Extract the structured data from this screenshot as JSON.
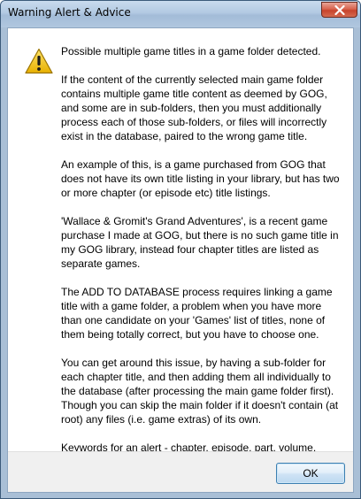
{
  "window": {
    "title": "Warning Alert & Advice"
  },
  "message": {
    "paragraphs": [
      "Possible multiple game titles in a game folder detected.",
      "If the content of the currently selected main game folder contains multiple game title content as deemed by GOG, and some are in sub-folders, then you must additionally process each of those sub-folders, or files will incorrectly exist in the database, paired to the wrong game title.",
      "An example of this, is a game purchased from GOG that does not have its own title listing in your library, but has two or more chapter (or episode etc) title listings.",
      "'Wallace & Gromit's Grand Adventures', is a recent game purchase I made at GOG, but there is no such game title in my GOG library, instead four chapter titles are listed as separate games.",
      "The ADD TO DATABASE process requires linking a game title with a game folder, a problem when you have more than one candidate on your 'Games' list of titles, none of them being totally correct, but you have to choose one.",
      "You can get around this issue, by having a sub-folder for each chapter title, and then adding them all individually to the database (after processing the main game folder first). Though you can skip the main folder if it doesn't contain (at root) any files (i.e. game extras) of its own.",
      "Keywords for an alert - chapter, episode, part, volume."
    ]
  },
  "buttons": {
    "ok_label": "OK"
  },
  "icons": {
    "close": "close-icon",
    "warning": "warning-icon"
  },
  "colors": {
    "titlebar": "#b2c9e2",
    "close_button": "#c7432b",
    "warning_yellow": "#f5c400",
    "footer": "#f0f0f0"
  }
}
